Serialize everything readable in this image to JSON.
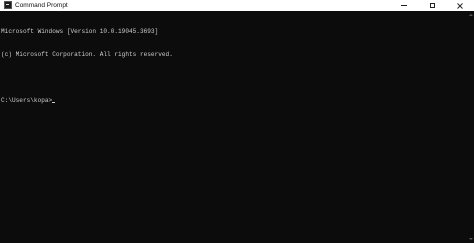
{
  "window": {
    "title": "Command Prompt",
    "controls": {
      "minimize": "minimize",
      "maximize": "maximize",
      "close": "close"
    }
  },
  "console": {
    "lines": [
      "Microsoft Windows [Version 10.0.19045.3693]",
      "(c) Microsoft Corporation. All rights reserved.",
      "",
      "C:\\Users\\kopa>"
    ]
  },
  "colors": {
    "background": "#0c0c0c",
    "text": "#cccccc",
    "titlebar": "#ffffff"
  },
  "icons": {
    "app": "command-prompt-icon",
    "minimize": "minimize-icon",
    "maximize": "maximize-icon",
    "close": "close-icon"
  }
}
